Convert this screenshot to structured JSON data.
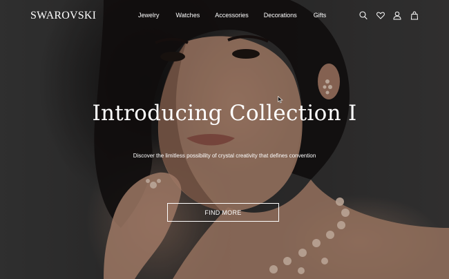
{
  "header": {
    "logo": "SWAROVSKI",
    "nav": [
      {
        "label": "Jewelry"
      },
      {
        "label": "Watches"
      },
      {
        "label": "Accessories"
      },
      {
        "label": "Decorations"
      },
      {
        "label": "Gifts"
      }
    ],
    "icons": [
      "search-icon",
      "heart-icon",
      "user-icon",
      "shopping-bag-icon"
    ]
  },
  "hero": {
    "title": "Introducing Collection I",
    "subtitle": "Discover the limitless possibility of crystal creativity that defines convention",
    "cta_label": "FIND MORE",
    "image": "portrait of woman wearing crystal jewelry"
  },
  "colors": {
    "text": "#ffffff",
    "background": "#2e2e2e"
  }
}
